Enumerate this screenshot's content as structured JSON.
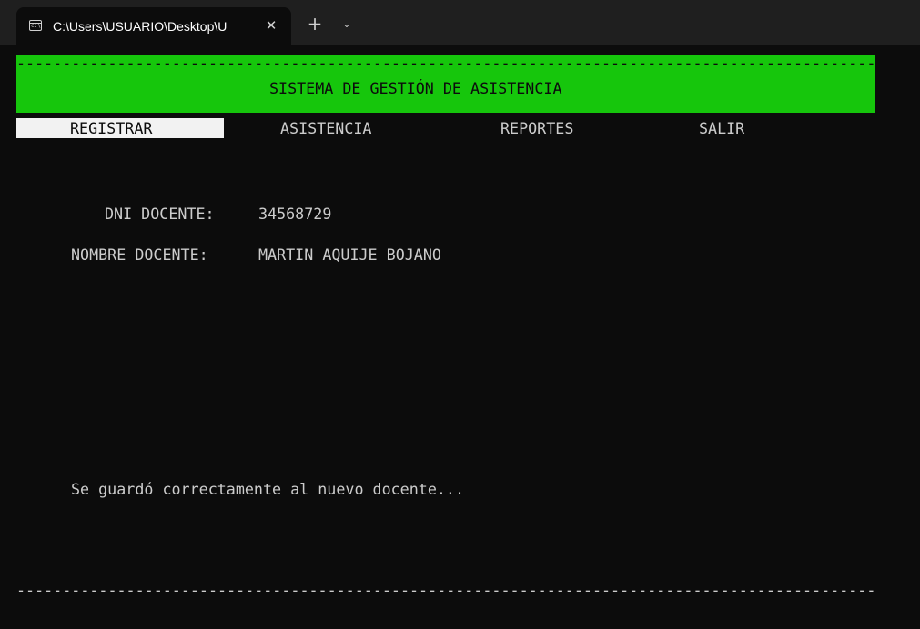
{
  "window": {
    "tab_title": "C:\\Users\\USUARIO\\Desktop\\U",
    "tab_icon": "console-icon",
    "close_glyph": "✕",
    "new_tab_glyph": "+",
    "dropdown_glyph": "⌄"
  },
  "app": {
    "dash_line": "------------------------------------------------------------------------------------------------",
    "header_title": "SISTEMA DE GESTIÓN DE ASISTENCIA",
    "menu": [
      {
        "label": "REGISTRAR",
        "selected": true
      },
      {
        "label": "ASISTENCIA",
        "selected": false
      },
      {
        "label": "REPORTES",
        "selected": false
      },
      {
        "label": "SALIR",
        "selected": false
      }
    ],
    "form": {
      "dni_label": "DNI DOCENTE:",
      "dni_value": "34568729",
      "nombre_label": "NOMBRE DOCENTE:",
      "nombre_value": "MARTIN AQUIJE BOJANO"
    },
    "status_message": "Se guardó correctamente al nuevo docente..."
  },
  "colors": {
    "header_bg": "#16c60c",
    "terminal_bg": "#0c0c0c",
    "text": "#cccccc",
    "selected_bg": "#f2f2f2"
  }
}
